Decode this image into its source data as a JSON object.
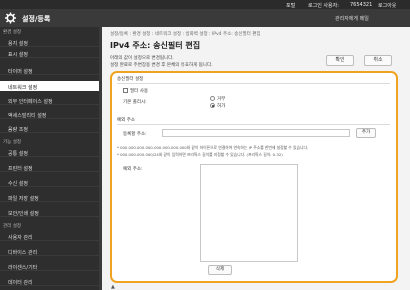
{
  "topbar": {
    "settings_link": "포털",
    "login_user_label": "로그인 사용자:",
    "user_id": "7654321",
    "logout": "로그아웃"
  },
  "header": {
    "title": "설정/등록",
    "admin_mode": "관리자에게 메일"
  },
  "sidebar": {
    "sections": [
      {
        "label": "환경 설정",
        "items": [
          "용지 설정",
          "표시 설정",
          "타이머 설정",
          "네트워크 설정",
          "외부 인터페이스 설정",
          "액세스빌리티 설정",
          "음량 조정"
        ]
      },
      {
        "label": "기능 설정",
        "items": [
          "공통 설정",
          "프린터 설정",
          "수신 설정",
          "파일 저장 설정",
          "보안/인쇄 설정"
        ]
      },
      {
        "label": "관리 설정",
        "items": [
          "사용자 관리",
          "디바이스 관리",
          "라이센스/기타",
          "데이터 관리"
        ]
      }
    ],
    "active_item": "네트워크 설정"
  },
  "main": {
    "breadcrumb": "설정/등록 : 환경 설정 : 네트워크 설정 : 방화벽 설정 : IPv4 주소: 송신필터 편집",
    "title": "IPv4 주소: 송신필터 편집",
    "desc_line1": "아래의 값이 설정으로 변경됩니다.",
    "desc_line2": "설정 완료로 주변장용 변경 후 본체의 유효하게 됩니다.",
    "ok_button": "확인",
    "cancel_button": "취소"
  },
  "panel": {
    "filter_section": "송신필터 설정",
    "use_filter_label": "필터 사용",
    "default_policy_label": "기본 폴리시:",
    "policy_options": [
      "거부",
      "허가"
    ],
    "policy_selected": "허가",
    "exception_section": "예외 주소",
    "register_address_label": "등록할 주소:",
    "add_button": "추가",
    "note_1": "* 000.000.000.000-000.000.000.000와 같이 하이픈으로 연결하여 연속하는 IP 주소를 한번에 설정할 수 있습니다.",
    "note_2": "* 000.000.000.000/24와 같이 입력하면 프리픽스 길이를 지정할 수 있습니다. (프리픽스 길이: 0-32)",
    "exception_address_label": "예외 주소:",
    "delete_button": "삭제"
  },
  "footer": {
    "to_top": "▲"
  },
  "colors": {
    "accent": "#f0a320",
    "header_bg": "#3a3a3a",
    "sidebar_bg": "#2e2e2e"
  }
}
